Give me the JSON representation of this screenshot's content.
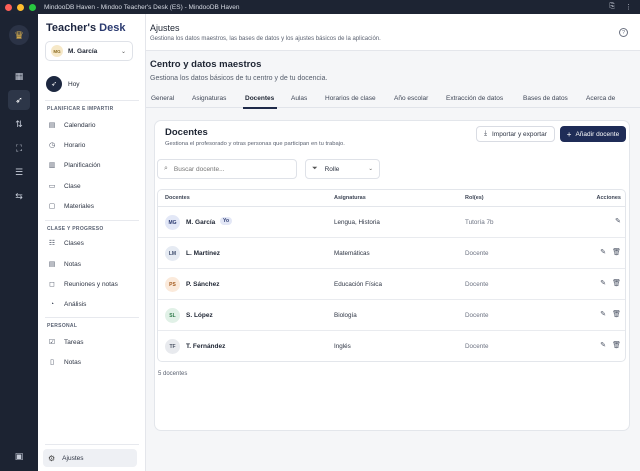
{
  "window": {
    "title": "MindooDB Haven - Mindoo Teacher's Desk (ES) - MindooDB Haven",
    "traffic_colors": [
      "#fe5f57",
      "#febc2e",
      "#28c840"
    ]
  },
  "brand": {
    "part1": "Teacher's ",
    "part2": "Desk"
  },
  "user": {
    "initials": "MG",
    "name": "M. García"
  },
  "sidebar": {
    "today": "Hoy",
    "sections": {
      "plan": "PLANIFICAR E IMPARTIR",
      "class": "CLASE Y PROGRESO",
      "personal": "PERSONAL"
    },
    "plan_items": [
      "Calendario",
      "Horario",
      "Planificación",
      "Clase",
      "Materiales"
    ],
    "class_items": [
      "Clases",
      "Notas",
      "Reuniones y notas",
      "Análisis"
    ],
    "personal_items": [
      "Tareas",
      "Notas"
    ],
    "settings": "Ajustes"
  },
  "header": {
    "title": "Ajustes",
    "subtitle": "Gestiona los datos maestros, las bases de datos y los ajustes básicos de la aplicación."
  },
  "main": {
    "title": "Centro y datos maestros",
    "subtitle": "Gestiona los datos básicos de tu centro y de tu docencia.",
    "tabs": [
      "General",
      "Asignaturas",
      "Docentes",
      "Aulas",
      "Horarios de clase",
      "Año escolar",
      "Extracción de datos",
      "Bases de datos",
      "Acerca de"
    ],
    "active_tab": "Docentes"
  },
  "card": {
    "title": "Docentes",
    "subtitle": "Gestiona el profesorado y otras personas que participan en tu trabajo.",
    "import_label": "Importar y exportar",
    "add_label": "Añadir docente",
    "search_placeholder": "Buscar docente...",
    "role_filter": "Rolle",
    "columns": [
      "Docentes",
      "Asignaturas",
      "Rol(es)",
      "Acciones"
    ],
    "me_badge": "Yo",
    "rows": [
      {
        "initials": "MG",
        "name": "M. García",
        "subjects": "Lengua, Historia",
        "role": "Tutoría 7b",
        "me": true,
        "bg": "#e3e8f7",
        "fg": "#2b3a70"
      },
      {
        "initials": "LM",
        "name": "L. Martínez",
        "subjects": "Matemáticas",
        "role": "Docente",
        "me": false,
        "bg": "#e6ebf3",
        "fg": "#3b4a6b"
      },
      {
        "initials": "PS",
        "name": "P. Sánchez",
        "subjects": "Educación Física",
        "role": "Docente",
        "me": false,
        "bg": "#fbeadb",
        "fg": "#a35a1e"
      },
      {
        "initials": "SL",
        "name": "S. López",
        "subjects": "Biología",
        "role": "Docente",
        "me": false,
        "bg": "#e1f1e7",
        "fg": "#2f7a4a"
      },
      {
        "initials": "TF",
        "name": "T. Fernández",
        "subjects": "Inglés",
        "role": "Docente",
        "me": false,
        "bg": "#e8eaee",
        "fg": "#4a5263"
      }
    ],
    "count_label": "5 docentes"
  }
}
